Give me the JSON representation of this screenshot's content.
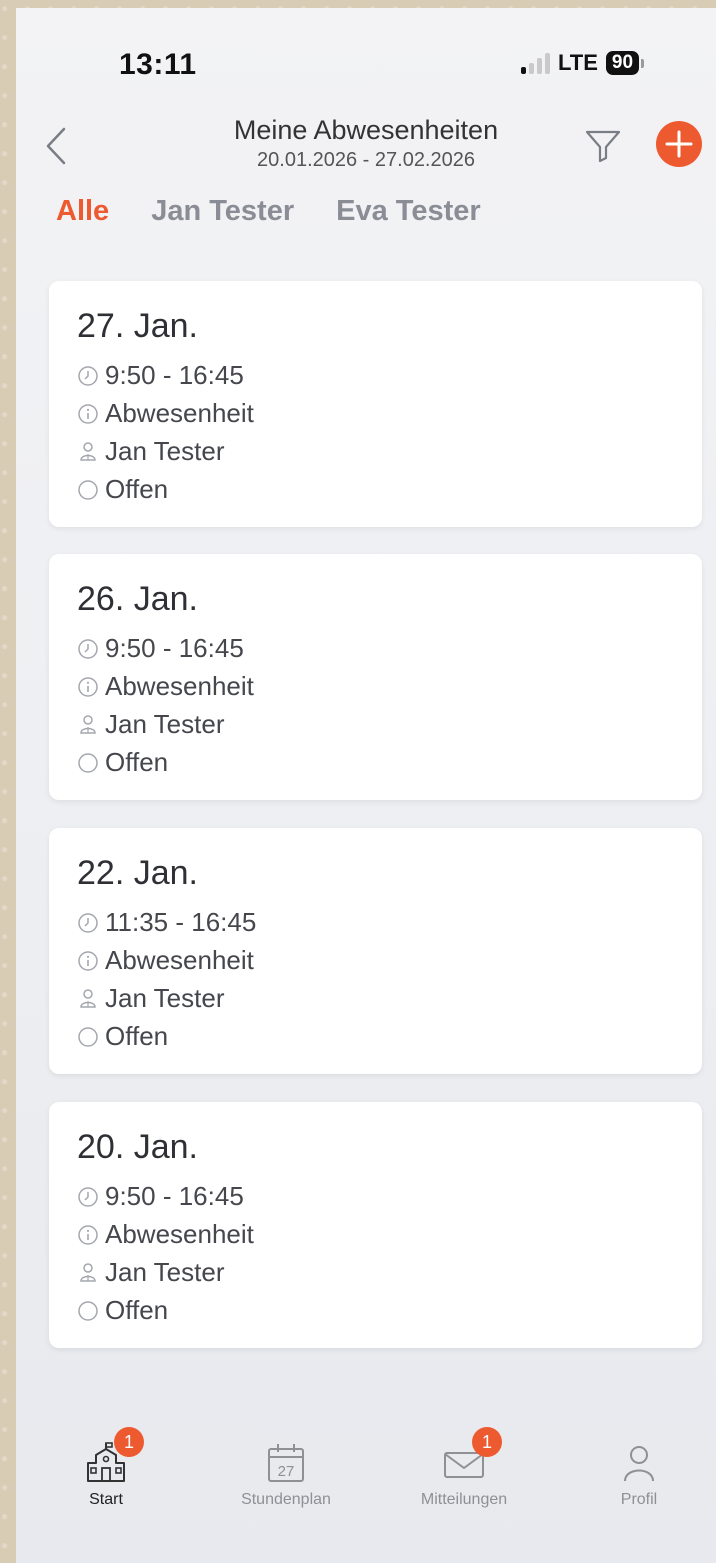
{
  "status_bar": {
    "time": "13:11",
    "network": "LTE",
    "battery": "90"
  },
  "nav": {
    "title": "Meine Abwesenheiten",
    "subtitle": "20.01.2026 - 27.02.2026"
  },
  "tabs": [
    {
      "label": "Alle",
      "active": true
    },
    {
      "label": "Jan Tester",
      "active": false
    },
    {
      "label": "Eva Tester",
      "active": false
    }
  ],
  "cards": [
    {
      "date": "27. Jan.",
      "time": "9:50 - 16:45",
      "type": "Abwesenheit",
      "person": "Jan Tester",
      "status": "Offen"
    },
    {
      "date": "26. Jan.",
      "time": "9:50 - 16:45",
      "type": "Abwesenheit",
      "person": "Jan Tester",
      "status": "Offen"
    },
    {
      "date": "22. Jan.",
      "time": "11:35 - 16:45",
      "type": "Abwesenheit",
      "person": "Jan Tester",
      "status": "Offen"
    },
    {
      "date": "20. Jan.",
      "time": "9:50 - 16:45",
      "type": "Abwesenheit",
      "person": "Jan Tester",
      "status": "Offen"
    }
  ],
  "tab_bar": {
    "items": [
      {
        "label": "Start",
        "icon": "school-icon",
        "badge": "1",
        "active": true
      },
      {
        "label": "Stundenplan",
        "icon": "calendar-icon",
        "calendar_day": "27",
        "active": false
      },
      {
        "label": "Mitteilungen",
        "icon": "mail-icon",
        "badge": "1",
        "active": false
      },
      {
        "label": "Profil",
        "icon": "person-icon",
        "active": false
      }
    ]
  },
  "colors": {
    "accent": "#ee5a2f",
    "muted_text": "#8a8d95",
    "card_bg": "#ffffff"
  }
}
